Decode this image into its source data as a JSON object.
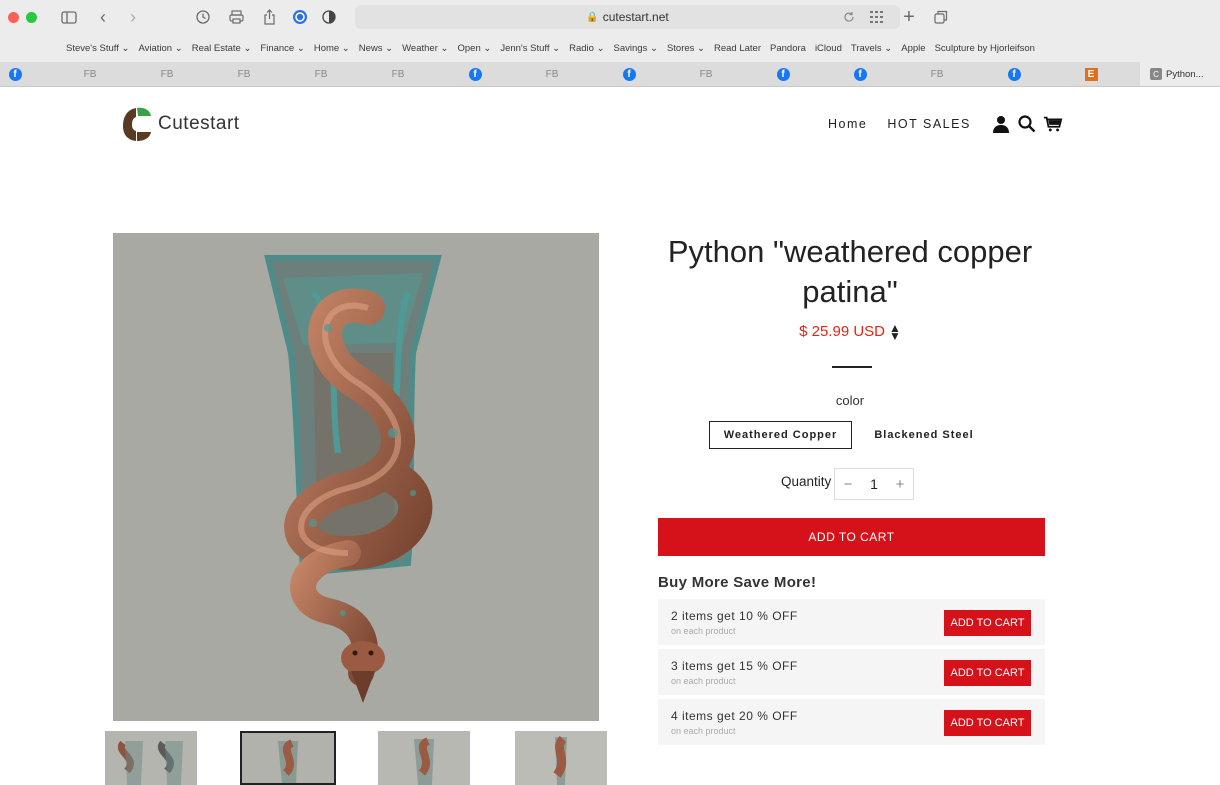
{
  "browser": {
    "url": "cutestart.net",
    "bookmarks": [
      "Steve's Stuff ⌄",
      "Aviation ⌄",
      "Real Estate ⌄",
      "Finance ⌄",
      "Home ⌄",
      "News ⌄",
      "Weather ⌄",
      "Open ⌄",
      "Jenn's Stuff ⌄",
      "Radio ⌄",
      "Savings ⌄",
      "Stores ⌄",
      "Read Later",
      "Pandora",
      "iCloud",
      "Travels ⌄",
      "Apple",
      "Sculpture by Hjorleifson"
    ],
    "tabs": {
      "fb_label": "FB",
      "facebook_glyph": "f",
      "etsy_glyph": "E",
      "active_label": "Python..."
    }
  },
  "site": {
    "logo_text": "Cutestart",
    "nav": {
      "home": "Home",
      "hot_sales": "HOT SALES"
    },
    "icons": {
      "account": "user-icon",
      "search": "search-icon",
      "cart": "cart-icon"
    }
  },
  "product": {
    "title": "Python \"weathered copper patina\"",
    "price": "$ 25.99 USD",
    "color_label": "color",
    "color_options": [
      "Weathered Copper",
      "Blackened Steel"
    ],
    "selected_color": "Weathered Copper",
    "quantity_label": "Quantity",
    "quantity": "1",
    "minus": "−",
    "plus": "+",
    "add_to_cart": "ADD TO CART"
  },
  "bundle": {
    "heading": "Buy More Save More!",
    "tiers": [
      {
        "title": "2 items get 10 % OFF",
        "sub": "on each product",
        "button": "ADD TO CART"
      },
      {
        "title": "3 items get 15 % OFF",
        "sub": "on each product",
        "button": "ADD TO CART"
      },
      {
        "title": "4 items get 20 % OFF",
        "sub": "on each product",
        "button": "ADD TO CART"
      }
    ]
  },
  "colors": {
    "accent_red": "#d5111a",
    "price_red": "#e32417",
    "copper": "#a86a4e",
    "patina": "#4e9a96"
  }
}
